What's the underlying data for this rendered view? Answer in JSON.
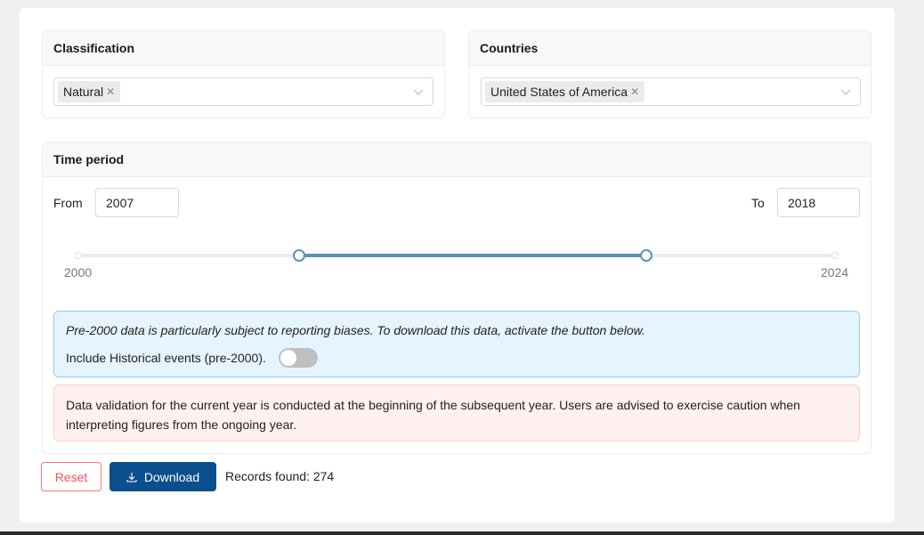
{
  "classification": {
    "title": "Classification",
    "selected": [
      "Natural"
    ],
    "dropdown_icon": "chevron-down-icon"
  },
  "countries": {
    "title": "Countries",
    "selected": [
      "United States of America"
    ],
    "dropdown_icon": "chevron-down-icon"
  },
  "time_period": {
    "title": "Time period",
    "from_label": "From",
    "from_value": "2007",
    "to_label": "To",
    "to_value": "2018",
    "slider": {
      "min": 2000,
      "max": 2024,
      "min_label": "2000",
      "max_label": "2024",
      "range": [
        2007,
        2018
      ]
    }
  },
  "info_alert": {
    "text": "Pre-2000 data is particularly subject to reporting biases. To download this data, activate the button below.",
    "toggle_label": "Include Historical events (pre-2000).",
    "toggle_on": false
  },
  "warning_alert": {
    "text": "Data validation for the current year is conducted at the beginning of the subsequent year. Users are advised to exercise caution when interpreting figures from the ongoing year."
  },
  "actions": {
    "reset_label": "Reset",
    "download_label": "Download",
    "download_icon": "download-icon",
    "records_found": "Records found: 274"
  },
  "colors": {
    "accent": "#5b94b5",
    "primary_button": "#0b4f8f",
    "danger": "#ff4d4f",
    "info_bg": "#e6f4ff",
    "warn_bg": "#fff1f0"
  }
}
